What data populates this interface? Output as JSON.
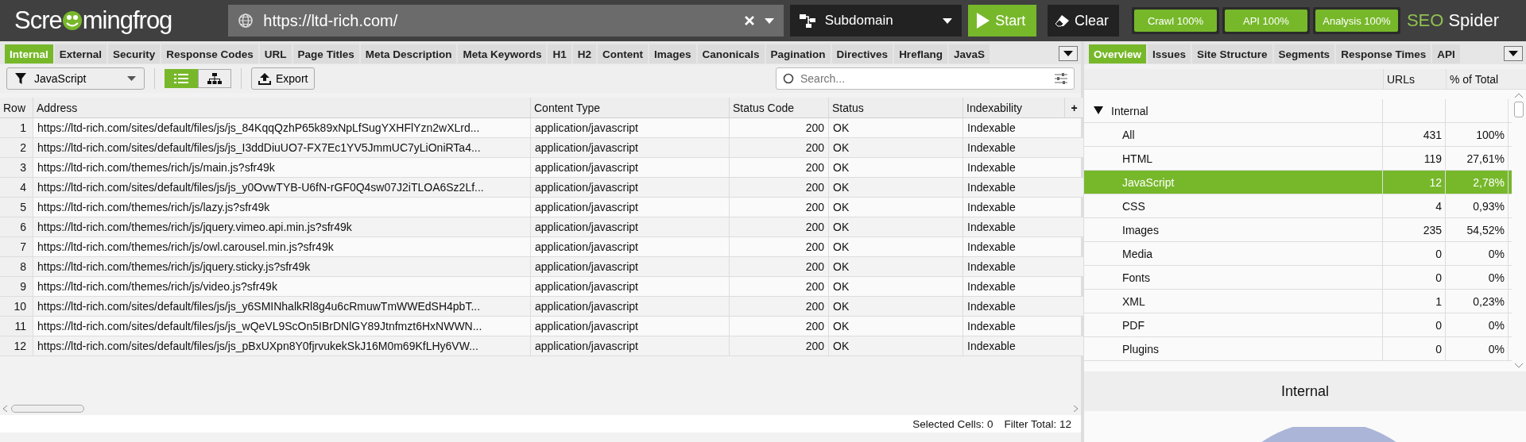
{
  "header": {
    "logo": {
      "before": "Scre",
      "after": "mingfrog"
    },
    "url": "https://ltd-rich.com/",
    "mode": "Subdomain",
    "start": "Start",
    "clear": "Clear",
    "progress": [
      {
        "label": "Crawl 100%",
        "level": 1
      },
      {
        "label": "API 100%",
        "level": 1
      },
      {
        "label": "Analysis 100%",
        "level": 1
      }
    ],
    "brand": {
      "first": "SEO",
      "second": "Spider"
    }
  },
  "left_tabs": [
    {
      "label": "Internal",
      "selected": true
    },
    {
      "label": "External",
      "selected": false
    },
    {
      "label": "Security",
      "selected": false
    },
    {
      "label": "Response Codes",
      "selected": false
    },
    {
      "label": "URL",
      "selected": false
    },
    {
      "label": "Page Titles",
      "selected": false
    },
    {
      "label": "Meta Description",
      "selected": false
    },
    {
      "label": "Meta Keywords",
      "selected": false
    },
    {
      "label": "H1",
      "selected": false
    },
    {
      "label": "H2",
      "selected": false
    },
    {
      "label": "Content",
      "selected": false
    },
    {
      "label": "Images",
      "selected": false
    },
    {
      "label": "Canonicals",
      "selected": false
    },
    {
      "label": "Pagination",
      "selected": false
    },
    {
      "label": "Directives",
      "selected": false
    },
    {
      "label": "Hreflang",
      "selected": false
    },
    {
      "label": "JavaS",
      "selected": false
    }
  ],
  "toolbar": {
    "filter": "JavaScript",
    "views": [
      {
        "kind": "list",
        "selected": true
      },
      {
        "kind": "tree",
        "selected": false
      }
    ],
    "export": "Export",
    "search": {
      "placeholder": "Search..."
    }
  },
  "table": {
    "columns": [
      "Row",
      "Address",
      "Content Type",
      "Status Code",
      "Status",
      "Indexability"
    ],
    "add_column": "+",
    "rows": [
      [
        "1",
        "https://ltd-rich.com/sites/default/files/js/js_84KqqQzhP65k89xNpLfSugYXHFlYzn2wXLrd...",
        "application/javascript",
        "200",
        "OK",
        "Indexable"
      ],
      [
        "2",
        "https://ltd-rich.com/sites/default/files/js/js_I3ddDiuUO7-FX7Ec1YV5JmmUC7yLiOniRTa4...",
        "application/javascript",
        "200",
        "OK",
        "Indexable"
      ],
      [
        "3",
        "https://ltd-rich.com/themes/rich/js/main.js?sfr49k",
        "application/javascript",
        "200",
        "OK",
        "Indexable"
      ],
      [
        "4",
        "https://ltd-rich.com/sites/default/files/js/js_y0OvwTYB-U6fN-rGF0Q4sw07J2iTLOA6Sz2Lf...",
        "application/javascript",
        "200",
        "OK",
        "Indexable"
      ],
      [
        "5",
        "https://ltd-rich.com/themes/rich/js/lazy.js?sfr49k",
        "application/javascript",
        "200",
        "OK",
        "Indexable"
      ],
      [
        "6",
        "https://ltd-rich.com/themes/rich/js/jquery.vimeo.api.min.js?sfr49k",
        "application/javascript",
        "200",
        "OK",
        "Indexable"
      ],
      [
        "7",
        "https://ltd-rich.com/themes/rich/js/owl.carousel.min.js?sfr49k",
        "application/javascript",
        "200",
        "OK",
        "Indexable"
      ],
      [
        "8",
        "https://ltd-rich.com/themes/rich/js/jquery.sticky.js?sfr49k",
        "application/javascript",
        "200",
        "OK",
        "Indexable"
      ],
      [
        "9",
        "https://ltd-rich.com/themes/rich/js/video.js?sfr49k",
        "application/javascript",
        "200",
        "OK",
        "Indexable"
      ],
      [
        "10",
        "https://ltd-rich.com/sites/default/files/js/js_y6SMINhalkRl8g4u6cRmuwTmWWEdSH4pbT...",
        "application/javascript",
        "200",
        "OK",
        "Indexable"
      ],
      [
        "11",
        "https://ltd-rich.com/sites/default/files/js/js_wQeVL9ScOn5IBrDNlGY89Jtnfmzt6HxNWWN...",
        "application/javascript",
        "200",
        "OK",
        "Indexable"
      ],
      [
        "12",
        "https://ltd-rich.com/sites/default/files/js/js_pBxUXpn8Y0fjrvukekSkJ16M0m69KfLHy6VW...",
        "application/javascript",
        "200",
        "OK",
        "Indexable"
      ]
    ]
  },
  "status_bar": {
    "selected_cells": "Selected Cells: 0",
    "filter_total": "Filter Total: 12"
  },
  "right_tabs": [
    {
      "label": "Overview",
      "selected": true
    },
    {
      "label": "Issues",
      "selected": false
    },
    {
      "label": "Site Structure",
      "selected": false
    },
    {
      "label": "Segments",
      "selected": false
    },
    {
      "label": "Response Times",
      "selected": false
    },
    {
      "label": "API",
      "selected": false
    }
  ],
  "overview": {
    "columns": [
      "URLs",
      "% of Total"
    ],
    "tree": {
      "label": "Internal",
      "expanded": true,
      "children": [
        {
          "label": "All",
          "urls": "431",
          "percent": "100%",
          "selected": false
        },
        {
          "label": "HTML",
          "urls": "119",
          "percent": "27,61%",
          "selected": false
        },
        {
          "label": "JavaScript",
          "urls": "12",
          "percent": "2,78%",
          "selected": true
        },
        {
          "label": "CSS",
          "urls": "4",
          "percent": "0,93%",
          "selected": false
        },
        {
          "label": "Images",
          "urls": "235",
          "percent": "54,52%",
          "selected": false
        },
        {
          "label": "Media",
          "urls": "0",
          "percent": "0%",
          "selected": false
        },
        {
          "label": "Fonts",
          "urls": "0",
          "percent": "0%",
          "selected": false
        },
        {
          "label": "XML",
          "urls": "1",
          "percent": "0,23%",
          "selected": false
        },
        {
          "label": "PDF",
          "urls": "0",
          "percent": "0%",
          "selected": false
        },
        {
          "label": "Plugins",
          "urls": "0",
          "percent": "0%",
          "selected": false
        }
      ]
    },
    "chart_title": "Internal"
  }
}
